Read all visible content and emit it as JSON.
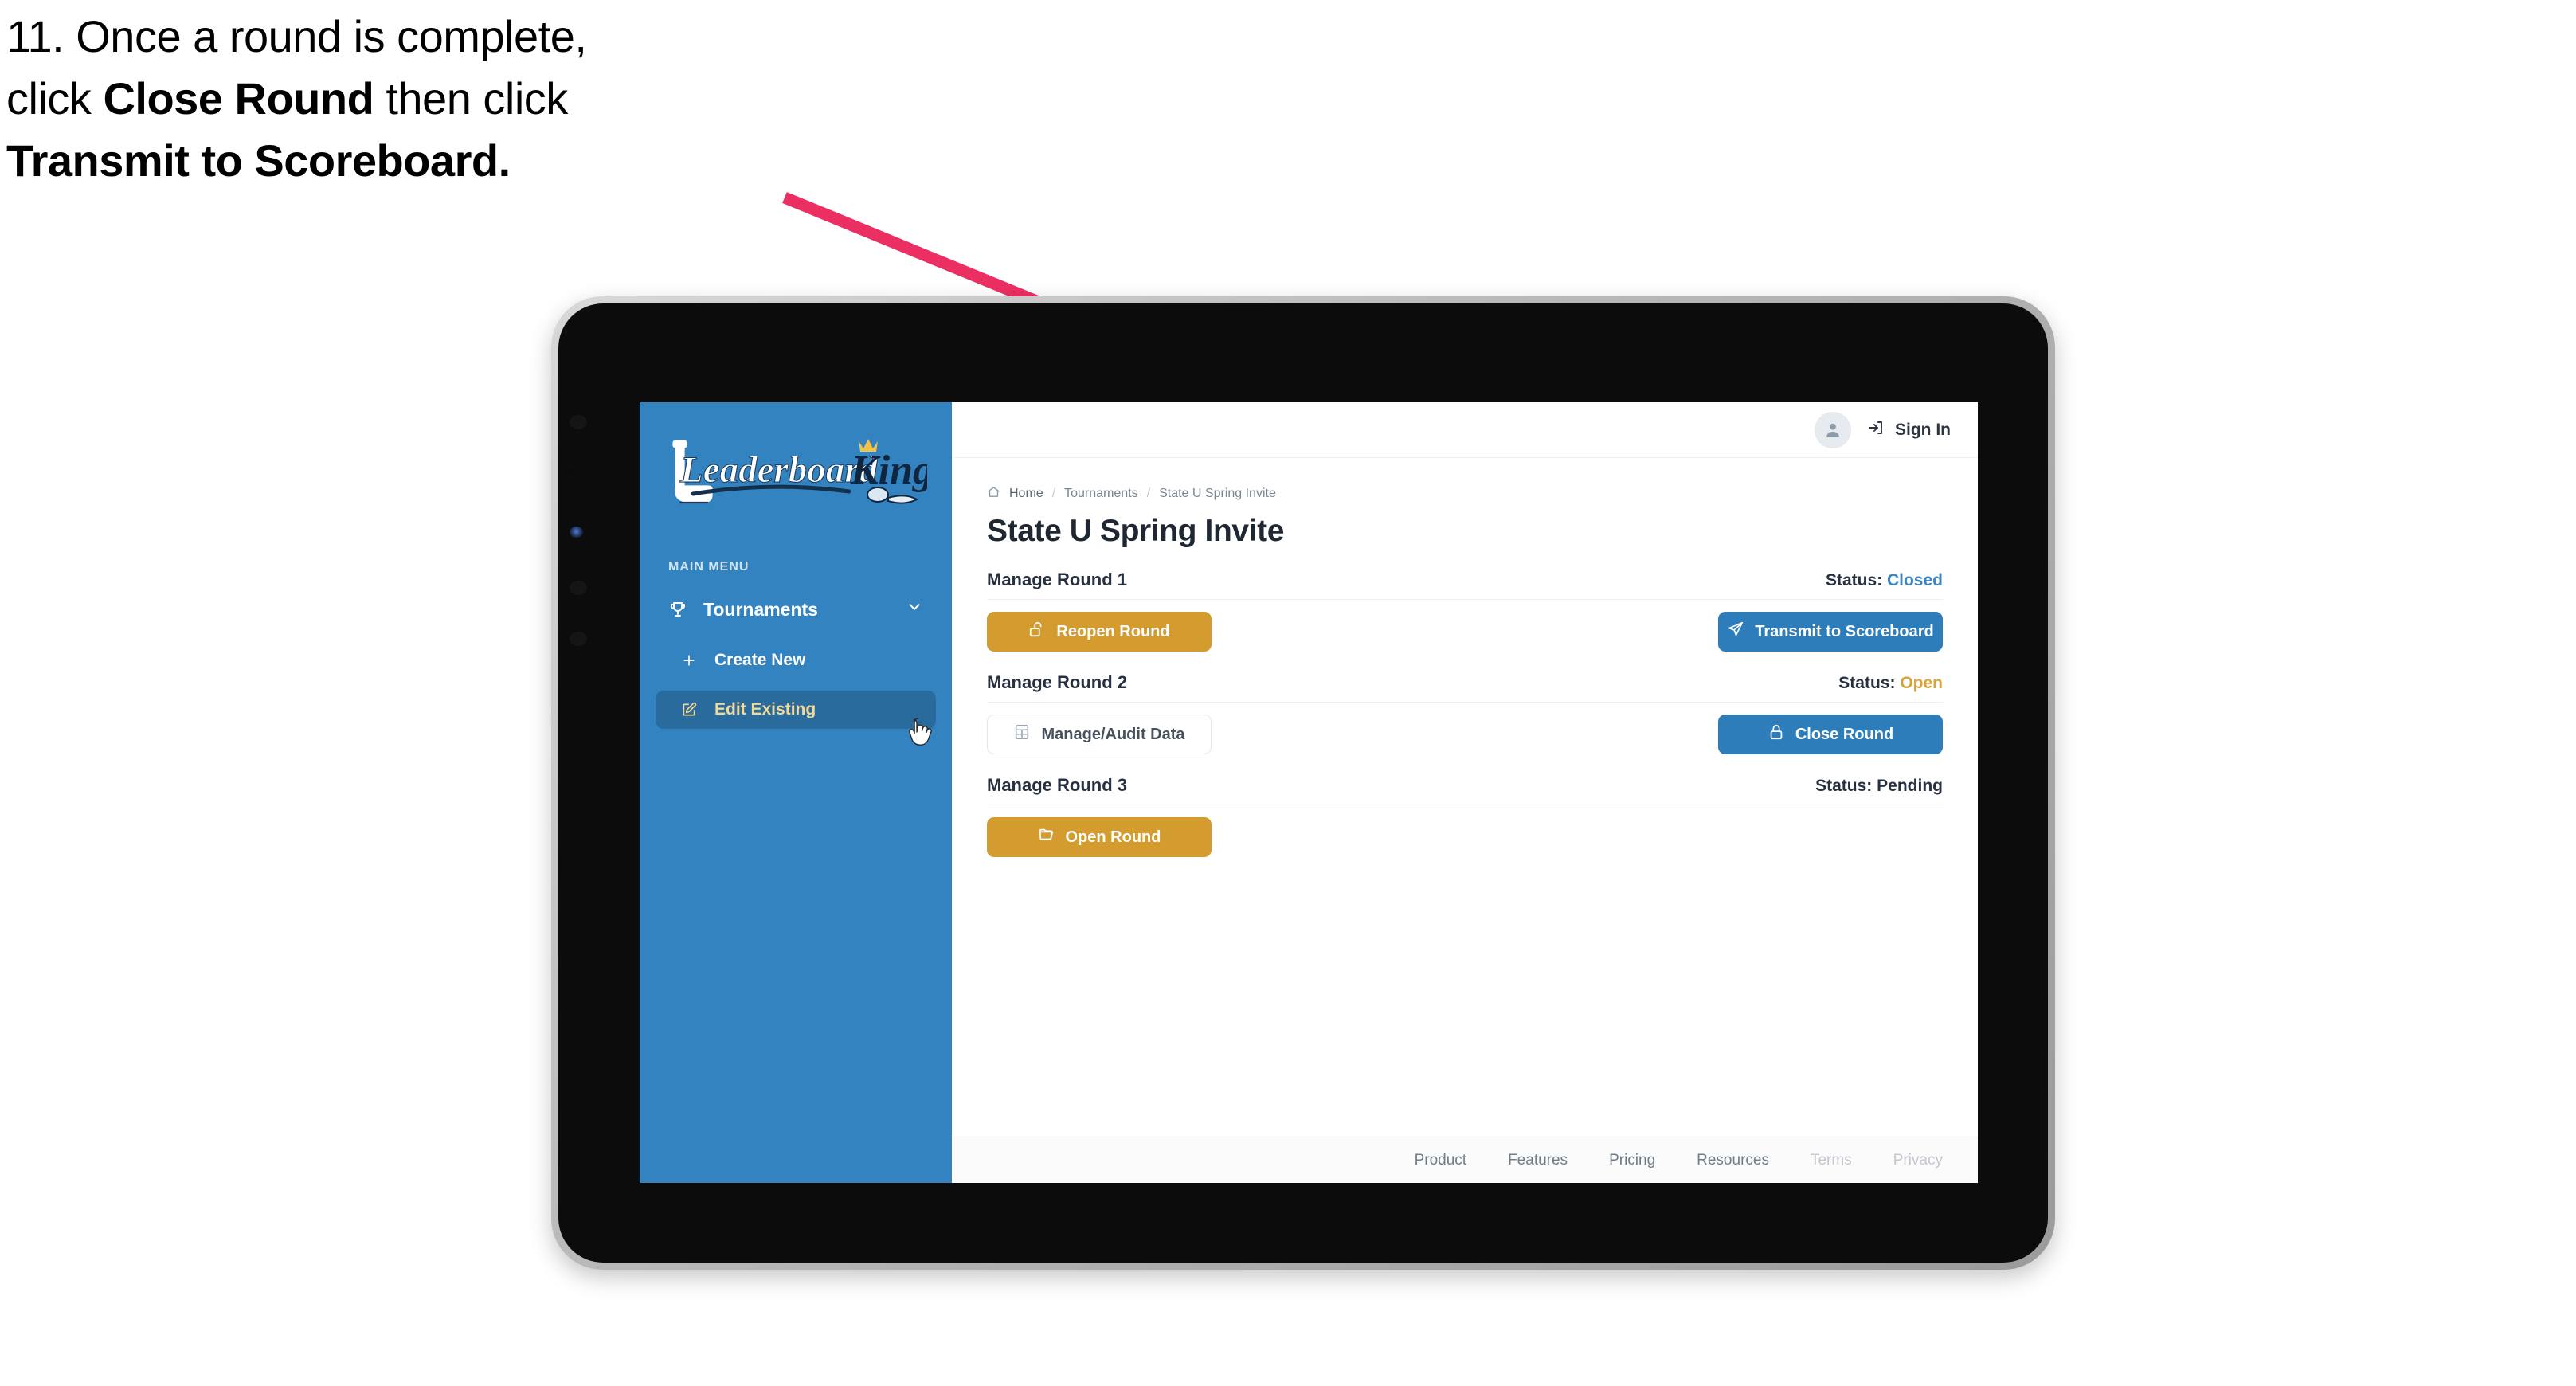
{
  "caption": {
    "line1_pre": "11. Once a round is complete,",
    "line2_pre": "click ",
    "line2_bold": "Close Round",
    "line2_post": " then click",
    "line3_bold": "Transmit to Scoreboard."
  },
  "colors": {
    "sidebar_blue": "#3383c0",
    "sidebar_active": "#2a6b9d",
    "sidebar_active_text": "#f3d998",
    "gold": "#d49b2f",
    "blue": "#2d7dba",
    "status_closed": "#3b86c6",
    "status_open": "#d9a33b",
    "arrow_pink": "#ec2f63",
    "page_text": "#1f2733"
  },
  "sidebar": {
    "logo_text_left": "Leaderboard",
    "logo_text_right": "King",
    "section_label": "MAIN MENU",
    "items": [
      {
        "label": "Tournaments",
        "icon": "trophy-icon",
        "chevron": "chevron-down-icon",
        "active": false
      },
      {
        "label": "Create New",
        "icon": "plus-icon",
        "active": false
      },
      {
        "label": "Edit Existing",
        "icon": "edit-square-icon",
        "active": true
      }
    ]
  },
  "topbar": {
    "avatar_icon": "user-avatar-icon",
    "signin_icon": "sign-in-icon",
    "signin_label": "Sign In"
  },
  "breadcrumb": {
    "home_icon": "home-icon",
    "items": [
      "Home",
      "Tournaments",
      "State U Spring Invite"
    ],
    "separator": "/"
  },
  "page": {
    "title": "State U Spring Invite"
  },
  "rounds": [
    {
      "title": "Manage Round 1",
      "status_label": "Status:",
      "status_value": "Closed",
      "status_kind": "closed",
      "left_button": {
        "label": "Reopen Round",
        "icon": "unlock-icon",
        "style": "gold"
      },
      "right_button": {
        "label": "Transmit to Scoreboard",
        "icon": "paper-plane-icon",
        "style": "blue"
      }
    },
    {
      "title": "Manage Round 2",
      "status_label": "Status:",
      "status_value": "Open",
      "status_kind": "open",
      "left_button": {
        "label": "Manage/Audit Data",
        "icon": "spreadsheet-icon",
        "style": "ghost"
      },
      "right_button": {
        "label": "Close Round",
        "icon": "lock-icon",
        "style": "blue"
      }
    },
    {
      "title": "Manage Round 3",
      "status_label": "Status:",
      "status_value": "Pending",
      "status_kind": "plain",
      "left_button": {
        "label": "Open Round",
        "icon": "folder-open-icon",
        "style": "gold"
      },
      "right_button": null
    }
  ],
  "footer": {
    "links": [
      {
        "label": "Product",
        "dim": false
      },
      {
        "label": "Features",
        "dim": false
      },
      {
        "label": "Pricing",
        "dim": false
      },
      {
        "label": "Resources",
        "dim": false
      },
      {
        "label": "Terms",
        "dim": true
      },
      {
        "label": "Privacy",
        "dim": true
      }
    ]
  }
}
